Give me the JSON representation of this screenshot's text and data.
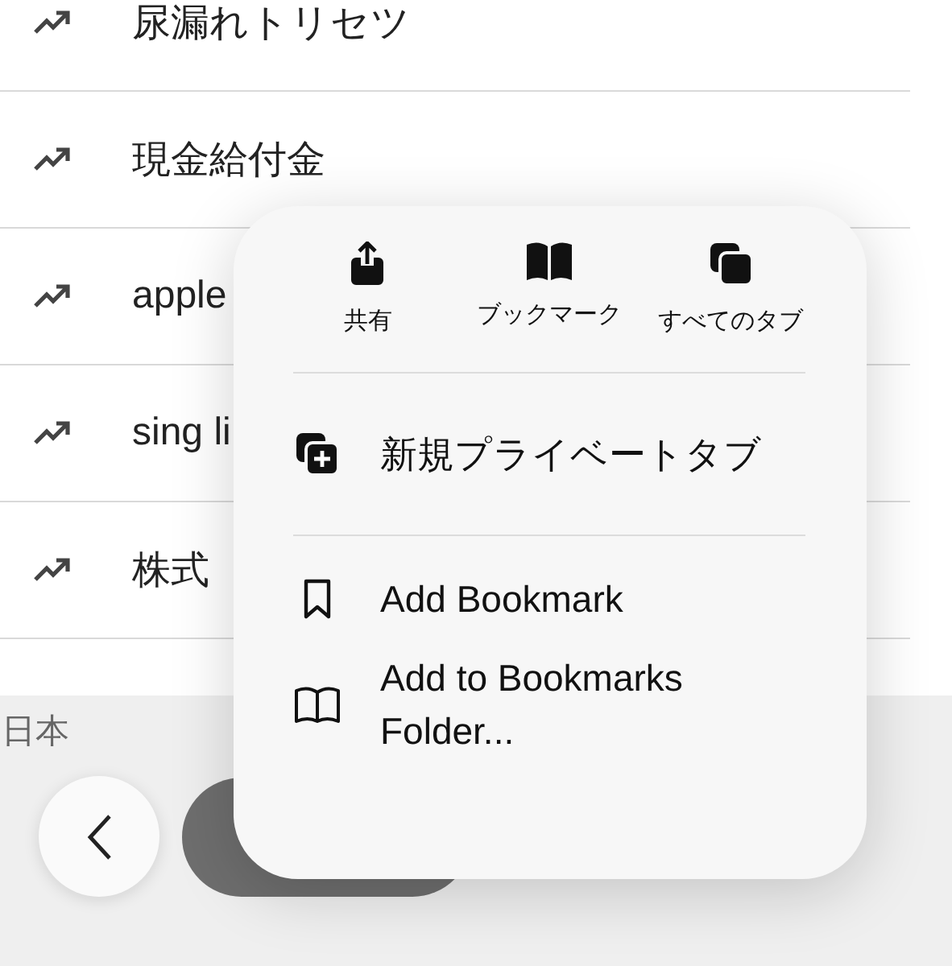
{
  "trending": [
    {
      "text": "尿漏れトリセツ"
    },
    {
      "text": "現金給付金"
    },
    {
      "text": "apple"
    },
    {
      "text": "sing li"
    },
    {
      "text": "株式"
    }
  ],
  "region": "日本",
  "menu": {
    "actions": [
      {
        "kind": "share",
        "label": "共有"
      },
      {
        "kind": "bookmarks",
        "label": "ブックマーク"
      },
      {
        "kind": "tabs",
        "label": "すべてのタブ"
      }
    ],
    "sections": [
      [
        {
          "kind": "private",
          "label": "新規プライベートタブ"
        }
      ],
      [
        {
          "kind": "bookmark",
          "label": "Add Bookmark"
        },
        {
          "kind": "folder",
          "label": "Add to Bookmarks Folder..."
        }
      ]
    ]
  }
}
